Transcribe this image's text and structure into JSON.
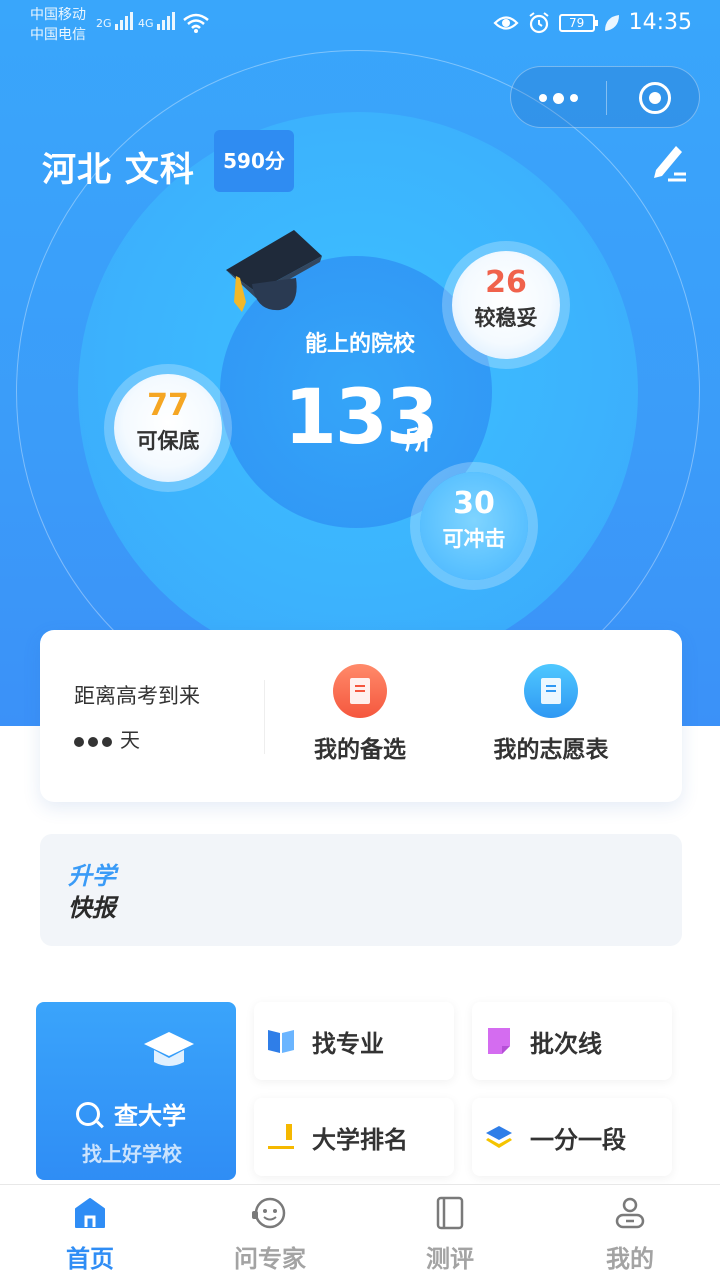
{
  "status_bar": {
    "carrier_1": "中国移动",
    "carrier_2": "中国电信",
    "net_1": "2G",
    "net_2": "4G",
    "battery": "79",
    "time": "14:35"
  },
  "header": {
    "region_subject": "河北 文科",
    "score": "590分"
  },
  "summary": {
    "label": "能上的院校",
    "total": "133",
    "unit": "所",
    "stable": {
      "count": "26",
      "label": "较稳妥"
    },
    "safe": {
      "count": "77",
      "label": "可保底"
    },
    "rush": {
      "count": "30",
      "label": "可冲击"
    }
  },
  "card": {
    "countdown_label": "距离高考到来",
    "countdown_unit": "天",
    "favorites_label": "我的备选",
    "wishlist_label": "我的志愿表"
  },
  "news": {
    "line1": "升学",
    "line2": "快报"
  },
  "grid": {
    "find_university": {
      "title": "查大学",
      "subtitle": "找上好学校"
    },
    "find_major": "找专业",
    "batch_line": "批次线",
    "university_ranking": "大学排名",
    "score_segment": "一分一段"
  },
  "tabbar": {
    "home": "首页",
    "expert": "问专家",
    "evaluation": "测评",
    "mine": "我的"
  },
  "colors": {
    "primary": "#2f8df5",
    "stable": "#f0624c",
    "safe": "#f5a623"
  }
}
